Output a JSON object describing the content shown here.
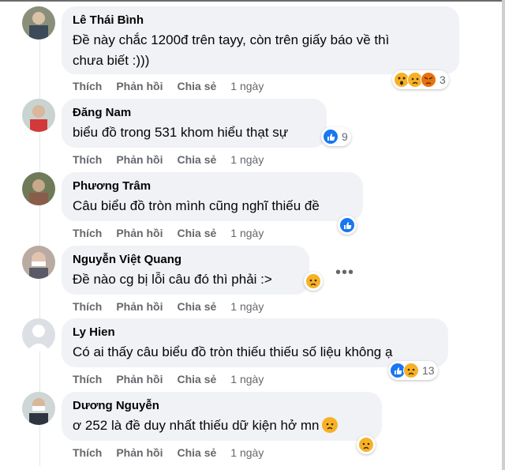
{
  "actions": {
    "like": "Thích",
    "reply": "Phản hồi",
    "share": "Chia sẻ"
  },
  "comments": [
    {
      "author": "Lê Thái Bình",
      "text": "Đề này chắc 1200đ trên tayy, còn trên giấy báo về thì\nchưa biết :)))",
      "time": "1 ngày",
      "reaction_count": "3",
      "reactions": [
        "wow-icon",
        "sad-icon",
        "angry-icon"
      ]
    },
    {
      "author": "Đăng Nam",
      "text": "biểu đồ trong 531 khom hiểu thạt sự",
      "time": "1 ngày",
      "reaction_count": "9",
      "reactions": [
        "like-icon"
      ]
    },
    {
      "author": "Phương Trâm",
      "text": "Câu biểu đồ tròn mình cũng nghĩ thiếu đề",
      "time": "1 ngày",
      "reaction_count": "",
      "reactions": [
        "like-icon"
      ]
    },
    {
      "author": "Nguyễn Việt Quang",
      "text": "Đề nào cg bị lỗi câu đó thì phải :>",
      "time": "1 ngày",
      "reaction_count": "",
      "reactions": [
        "sad-icon"
      ]
    },
    {
      "author": "Ly Hien",
      "text": "Có ai thấy câu biểu đồ tròn thiếu thiếu số liệu không ạ",
      "time": "1 ngày",
      "reaction_count": "13",
      "reactions": [
        "like-icon",
        "sad-icon"
      ]
    },
    {
      "author": "Dương Nguyễn",
      "text": "ơ 252 là đề duy nhất thiếu dữ kiện hở mn",
      "time": "1 ngày",
      "reaction_count": "",
      "reactions": [
        "sad-icon"
      ]
    }
  ],
  "colors": {
    "bubble": "#f0f2f5",
    "like": "#1877f2",
    "emoji": "#f7b125",
    "angry": "#e9710f",
    "meta": "#65676b"
  }
}
